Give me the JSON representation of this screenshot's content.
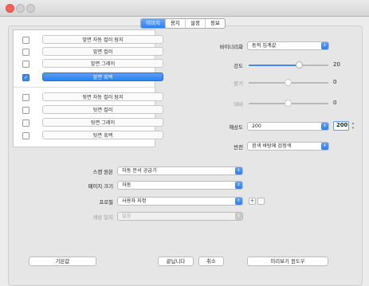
{
  "tabs": [
    "이미지",
    "용지",
    "설정",
    "정보"
  ],
  "scan_items": [
    {
      "label": "앞면 자동 컬러 탐지",
      "checked": false,
      "selected": false
    },
    {
      "label": "앞면 컬러",
      "checked": false,
      "selected": false
    },
    {
      "label": "앞면 그레이",
      "checked": false,
      "selected": false
    },
    {
      "label": "앞면 흑백",
      "checked": true,
      "selected": true
    },
    {
      "label": "뒷면 자동 컬러 탐지",
      "checked": false,
      "selected": false
    },
    {
      "label": "뒷면 컬러",
      "checked": false,
      "selected": false
    },
    {
      "label": "뒷면 그레이",
      "checked": false,
      "selected": false
    },
    {
      "label": "뒷면 흑백",
      "checked": false,
      "selected": false
    }
  ],
  "binarization": {
    "label": "바이너리화",
    "value": "동적 임계값"
  },
  "contrast": {
    "label": "강도",
    "value": "20",
    "level": 0.6
  },
  "brightness": {
    "label": "밝기",
    "value": "0",
    "level": 0.5
  },
  "gamma": {
    "label": "대비",
    "value": "0",
    "level": 0.5
  },
  "resolution": {
    "label": "해상도",
    "value": "200",
    "field": "200"
  },
  "invert": {
    "label": "반전",
    "value": "흰색 바탕에 검정색"
  },
  "scan_source": {
    "label": "스캔 원본",
    "value": "자동 문서 공급기"
  },
  "page_size": {
    "label": "페이지 크기",
    "value": "자동"
  },
  "profile": {
    "label": "프로필",
    "value": "사용자 지정",
    "add": "+",
    "remove": "-"
  },
  "color_match": {
    "label": "색상 일치",
    "value": "없음"
  },
  "buttons": {
    "defaults": "기본값",
    "done": "끝납니다",
    "cancel": "취소",
    "preview": "미리보기 윈도우"
  },
  "colors": {
    "accent": "#2f7ff0",
    "close": "#fc605c"
  }
}
